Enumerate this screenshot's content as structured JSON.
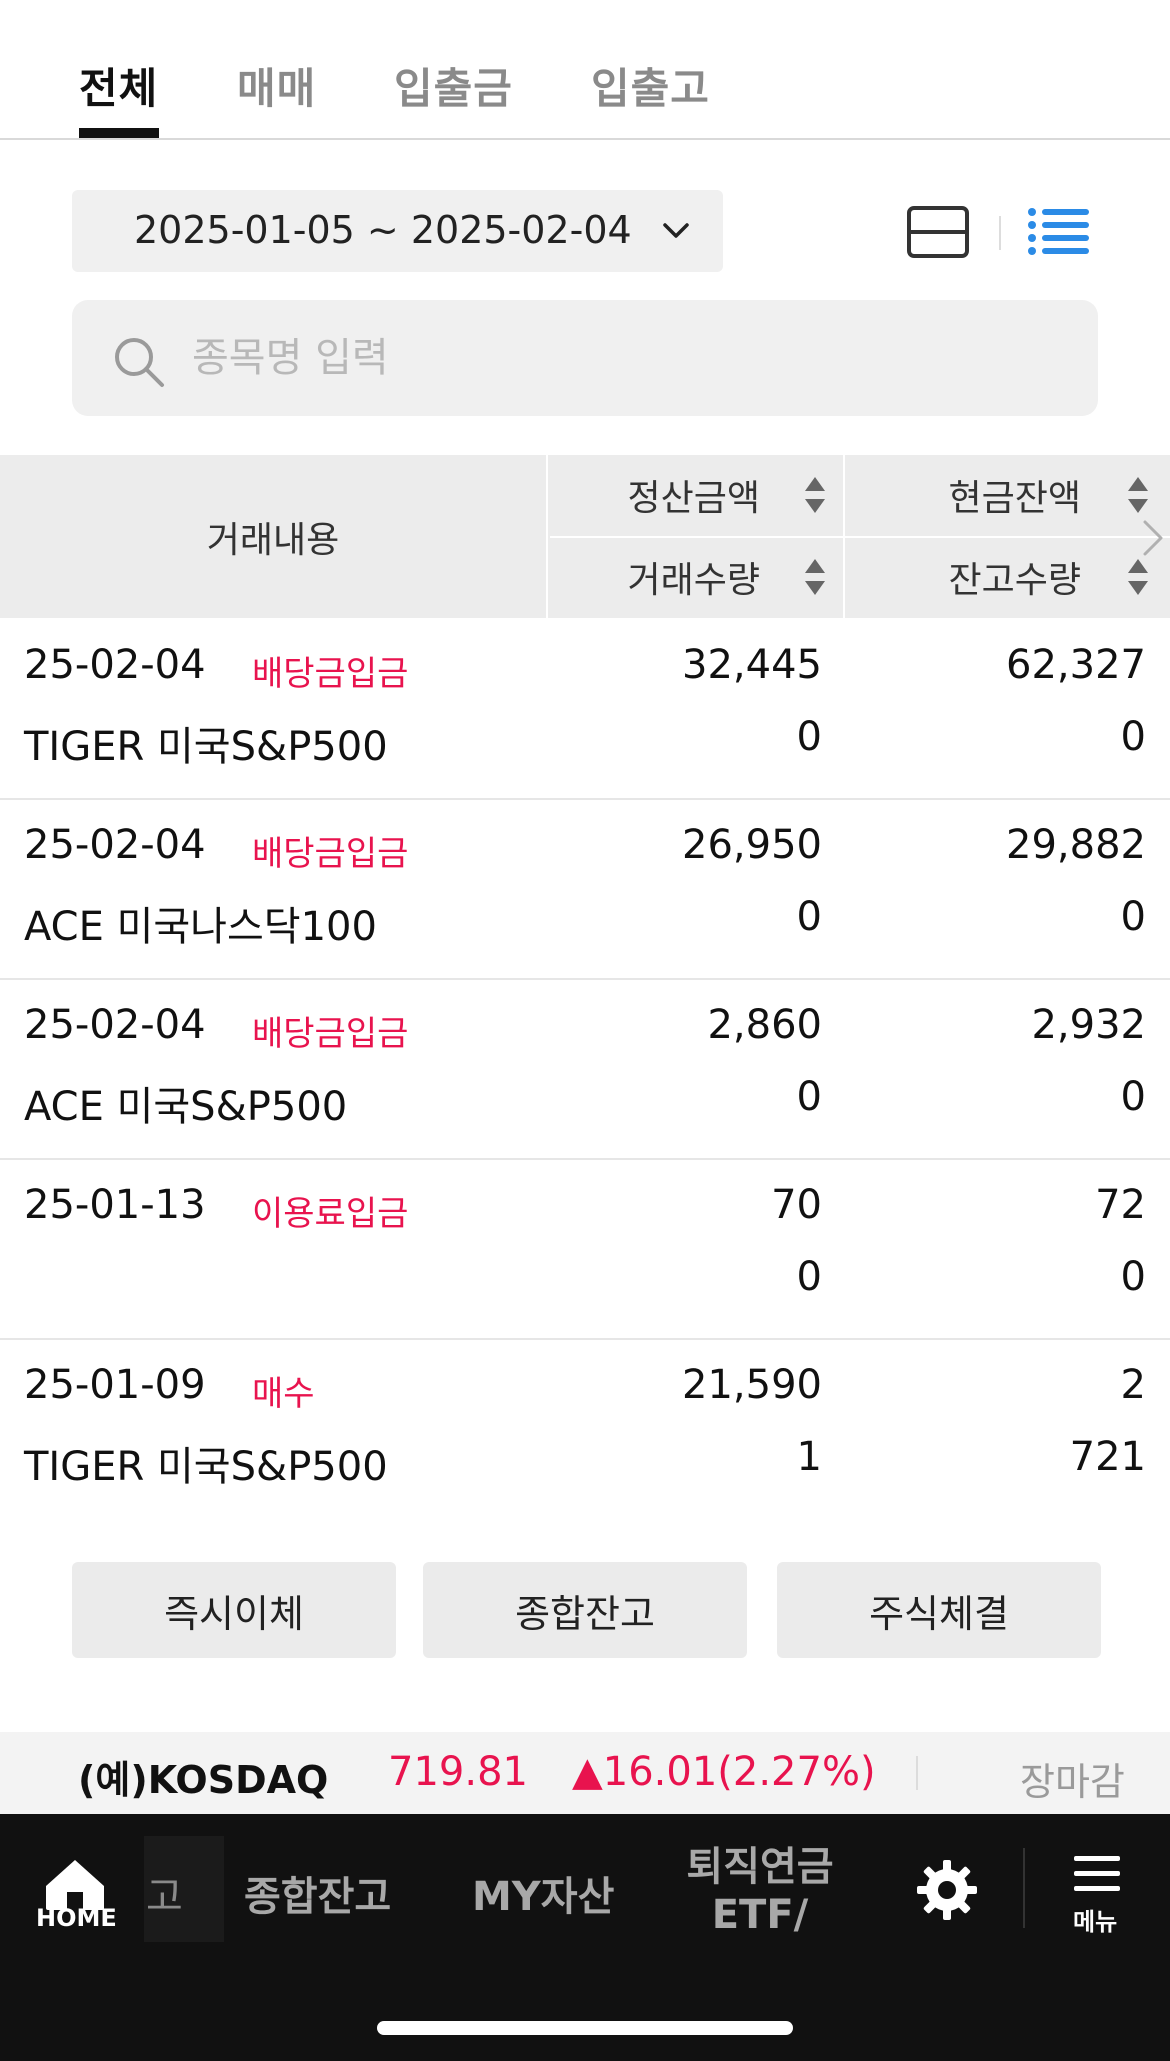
{
  "tabs": [
    {
      "label": "전체",
      "active": true
    },
    {
      "label": "매매",
      "active": false
    },
    {
      "label": "입출금",
      "active": false
    },
    {
      "label": "입출고",
      "active": false
    }
  ],
  "filter": {
    "date_range": "2025-01-05 ~ 2025-02-04"
  },
  "search": {
    "placeholder": "종목명 입력",
    "value": ""
  },
  "table": {
    "headers": {
      "main": "거래내용",
      "col1_top": "정산금액",
      "col1_bottom": "거래수량",
      "col2_top": "현금잔액",
      "col2_bottom": "잔고수량"
    },
    "rows": [
      {
        "date": "25-02-04",
        "type": "배당금입금",
        "name": "TIGER 미국S&P500",
        "settle": "32,445",
        "qty": "0",
        "cash": "62,327",
        "hold": "0"
      },
      {
        "date": "25-02-04",
        "type": "배당금입금",
        "name": "ACE 미국나스닥100",
        "settle": "26,950",
        "qty": "0",
        "cash": "29,882",
        "hold": "0"
      },
      {
        "date": "25-02-04",
        "type": "배당금입금",
        "name": "ACE 미국S&P500",
        "settle": "2,860",
        "qty": "0",
        "cash": "2,932",
        "hold": "0"
      },
      {
        "date": "25-01-13",
        "type": "이용료입금",
        "name": "",
        "settle": "70",
        "qty": "0",
        "cash": "72",
        "hold": "0"
      },
      {
        "date": "25-01-09",
        "type": "매수",
        "name": "TIGER 미국S&P500",
        "settle": "21,590",
        "qty": "1",
        "cash": "2",
        "hold": "721"
      }
    ]
  },
  "actions": {
    "instant_transfer": "즉시이체",
    "total_balance": "종합잔고",
    "stock_execution": "주식체결"
  },
  "ticker": {
    "name": "(예)KOSDAQ",
    "value": "719.81",
    "change": "▲16.01(2.27%)",
    "status": "장마감"
  },
  "bottom_nav": {
    "home": "HOME",
    "partial_item": "고",
    "item1": "종합잔고",
    "item2": "MY자산",
    "item3_line1": "퇴직연금",
    "item3_line2": "ETF/",
    "menu": "메뉴"
  },
  "colors": {
    "accent_red": "#e8134e",
    "list_blue": "#2b8be6",
    "nav_bg": "#111111"
  }
}
